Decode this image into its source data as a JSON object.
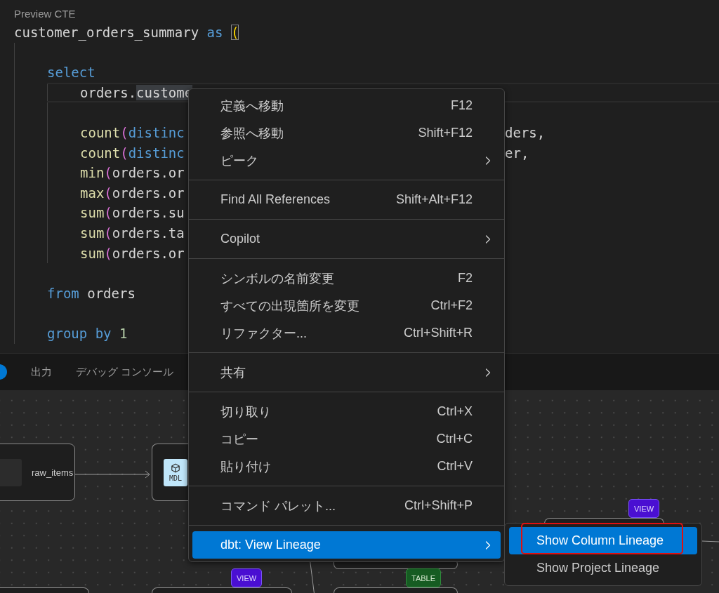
{
  "editor": {
    "codelens": "Preview CTE",
    "header": {
      "kind": "code",
      "segments": [
        {
          "kind": "plain",
          "text": "customer_orders_summary"
        },
        {
          "kind": "keyword",
          "text": " as "
        },
        {
          "kind": "bracket-match",
          "text": "("
        }
      ]
    },
    "body": [
      {
        "kind": "blank"
      },
      {
        "kind": "code",
        "segments": [
          {
            "kind": "keyword",
            "text": "select"
          }
        ]
      },
      {
        "kind": "block",
        "children": [
          {
            "kind": "code",
            "current": true,
            "segments": [
              {
                "kind": "plain",
                "text": "orders."
              },
              {
                "kind": "selected-word",
                "text": "custome"
              }
            ]
          },
          {
            "kind": "blank"
          },
          {
            "kind": "code",
            "segments": [
              {
                "kind": "function",
                "text": "count"
              },
              {
                "kind": "bracket",
                "text": "("
              },
              {
                "kind": "keyword",
                "text": "distinc"
              }
            ],
            "tail": "ders,"
          },
          {
            "kind": "code",
            "segments": [
              {
                "kind": "function",
                "text": "count"
              },
              {
                "kind": "bracket",
                "text": "("
              },
              {
                "kind": "keyword",
                "text": "distinc"
              }
            ],
            "tail": "er,"
          },
          {
            "kind": "code",
            "segments": [
              {
                "kind": "function",
                "text": "min"
              },
              {
                "kind": "bracket",
                "text": "("
              },
              {
                "kind": "plain",
                "text": "orders.or"
              }
            ]
          },
          {
            "kind": "code",
            "segments": [
              {
                "kind": "function",
                "text": "max"
              },
              {
                "kind": "bracket",
                "text": "("
              },
              {
                "kind": "plain",
                "text": "orders.or"
              }
            ]
          },
          {
            "kind": "code",
            "segments": [
              {
                "kind": "function",
                "text": "sum"
              },
              {
                "kind": "bracket",
                "text": "("
              },
              {
                "kind": "plain",
                "text": "orders.su"
              }
            ]
          },
          {
            "kind": "code",
            "segments": [
              {
                "kind": "function",
                "text": "sum"
              },
              {
                "kind": "bracket",
                "text": "("
              },
              {
                "kind": "plain",
                "text": "orders.ta"
              }
            ]
          },
          {
            "kind": "code",
            "segments": [
              {
                "kind": "function",
                "text": "sum"
              },
              {
                "kind": "bracket",
                "text": "("
              },
              {
                "kind": "plain",
                "text": "orders.or"
              }
            ]
          }
        ]
      },
      {
        "kind": "blank"
      },
      {
        "kind": "code",
        "segments": [
          {
            "kind": "keyword",
            "text": "from"
          },
          {
            "kind": "plain",
            "text": " orders"
          }
        ]
      },
      {
        "kind": "blank"
      },
      {
        "kind": "code",
        "segments": [
          {
            "kind": "keyword",
            "text": "group by"
          },
          {
            "kind": "number",
            "text": " 1"
          }
        ]
      }
    ]
  },
  "panel": {
    "tabs": [
      {
        "label": "出力",
        "selected": false
      },
      {
        "label": "デバッグ コンソール",
        "selected": false
      }
    ]
  },
  "lineage_graph": {
    "nodes": [
      {
        "kind": "source",
        "label": "raw_items"
      },
      {
        "kind": "model",
        "badge": "MDL"
      },
      {
        "kind": "plain"
      },
      {
        "kind": "plain"
      },
      {
        "kind": "view",
        "badge": "VIEW"
      },
      {
        "kind": "table",
        "badge": "TABLE"
      },
      {
        "kind": "view",
        "badge": "VIEW"
      }
    ]
  },
  "context_menu": {
    "groups": [
      [
        {
          "label": "定義へ移動",
          "shortcut": "F12",
          "submenu": false,
          "selected": false
        },
        {
          "label": "参照へ移動",
          "shortcut": "Shift+F12",
          "submenu": false,
          "selected": false
        },
        {
          "label": "ピーク",
          "submenu": true,
          "selected": false
        }
      ],
      [
        {
          "label": "Find All References",
          "shortcut": "Shift+Alt+F12",
          "submenu": false,
          "selected": false
        }
      ],
      [
        {
          "label": "Copilot",
          "submenu": true,
          "selected": false
        }
      ],
      [
        {
          "label": "シンボルの名前変更",
          "shortcut": "F2",
          "submenu": false,
          "selected": false
        },
        {
          "label": "すべての出現箇所を変更",
          "shortcut": "Ctrl+F2",
          "submenu": false,
          "selected": false
        },
        {
          "label": "リファクター...",
          "shortcut": "Ctrl+Shift+R",
          "submenu": false,
          "selected": false
        }
      ],
      [
        {
          "label": "共有",
          "submenu": true,
          "selected": false
        }
      ],
      [
        {
          "label": "切り取り",
          "shortcut": "Ctrl+X",
          "submenu": false,
          "selected": false
        },
        {
          "label": "コピー",
          "shortcut": "Ctrl+C",
          "submenu": false,
          "selected": false
        },
        {
          "label": "貼り付け",
          "shortcut": "Ctrl+V",
          "submenu": false,
          "selected": false
        }
      ],
      [
        {
          "label": "コマンド パレット...",
          "shortcut": "Ctrl+Shift+P",
          "submenu": false,
          "selected": false
        }
      ],
      [
        {
          "label": "dbt: View Lineage",
          "submenu": true,
          "selected": true
        }
      ]
    ]
  },
  "submenu": {
    "items": [
      {
        "label": "Show Column Lineage",
        "selected": true,
        "annotated": true
      },
      {
        "label": "Show Project Lineage",
        "selected": false,
        "annotated": false
      }
    ]
  }
}
